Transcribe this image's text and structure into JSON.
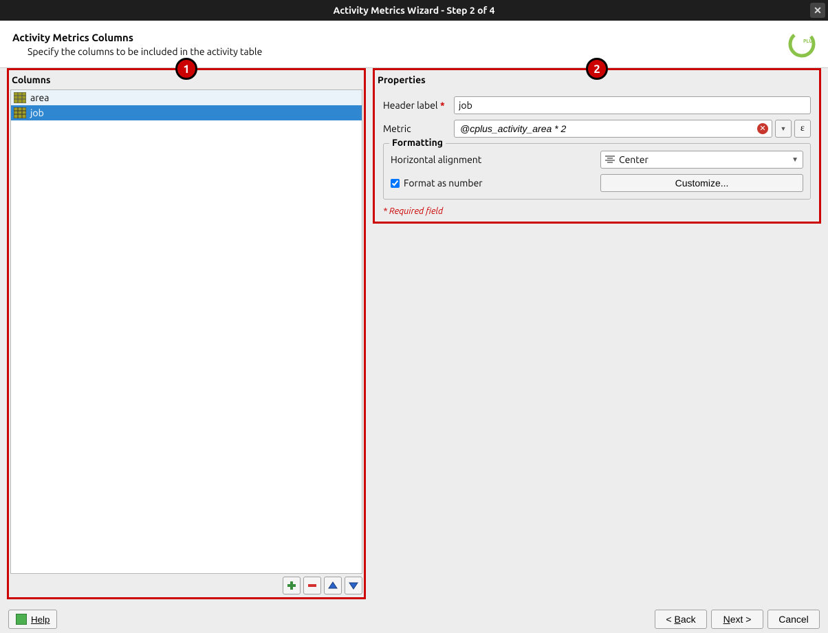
{
  "window": {
    "title": "Activity Metrics Wizard - Step 2 of 4"
  },
  "header": {
    "title": "Activity Metrics Columns",
    "subtitle": "Specify the columns to be included in the activity table"
  },
  "badges": {
    "left": "1",
    "right": "2"
  },
  "columns": {
    "title": "Columns",
    "items": [
      {
        "label": "area",
        "selected": false
      },
      {
        "label": "job",
        "selected": true
      }
    ]
  },
  "properties": {
    "title": "Properties",
    "header_label_label": "Header label",
    "header_label_value": "job",
    "metric_label": "Metric",
    "metric_value": "@cplus_activity_area * 2",
    "epsilon": "ε",
    "formatting": {
      "title": "Formatting",
      "h_align_label": "Horizontal alignment",
      "h_align_value": "Center",
      "format_as_number_label": "Format as number",
      "format_as_number_checked": true,
      "customize_label": "Customize..."
    },
    "required_note": "* Required field"
  },
  "footer": {
    "help": "Help",
    "back": "< Back",
    "next": "Next >",
    "cancel": "Cancel"
  }
}
